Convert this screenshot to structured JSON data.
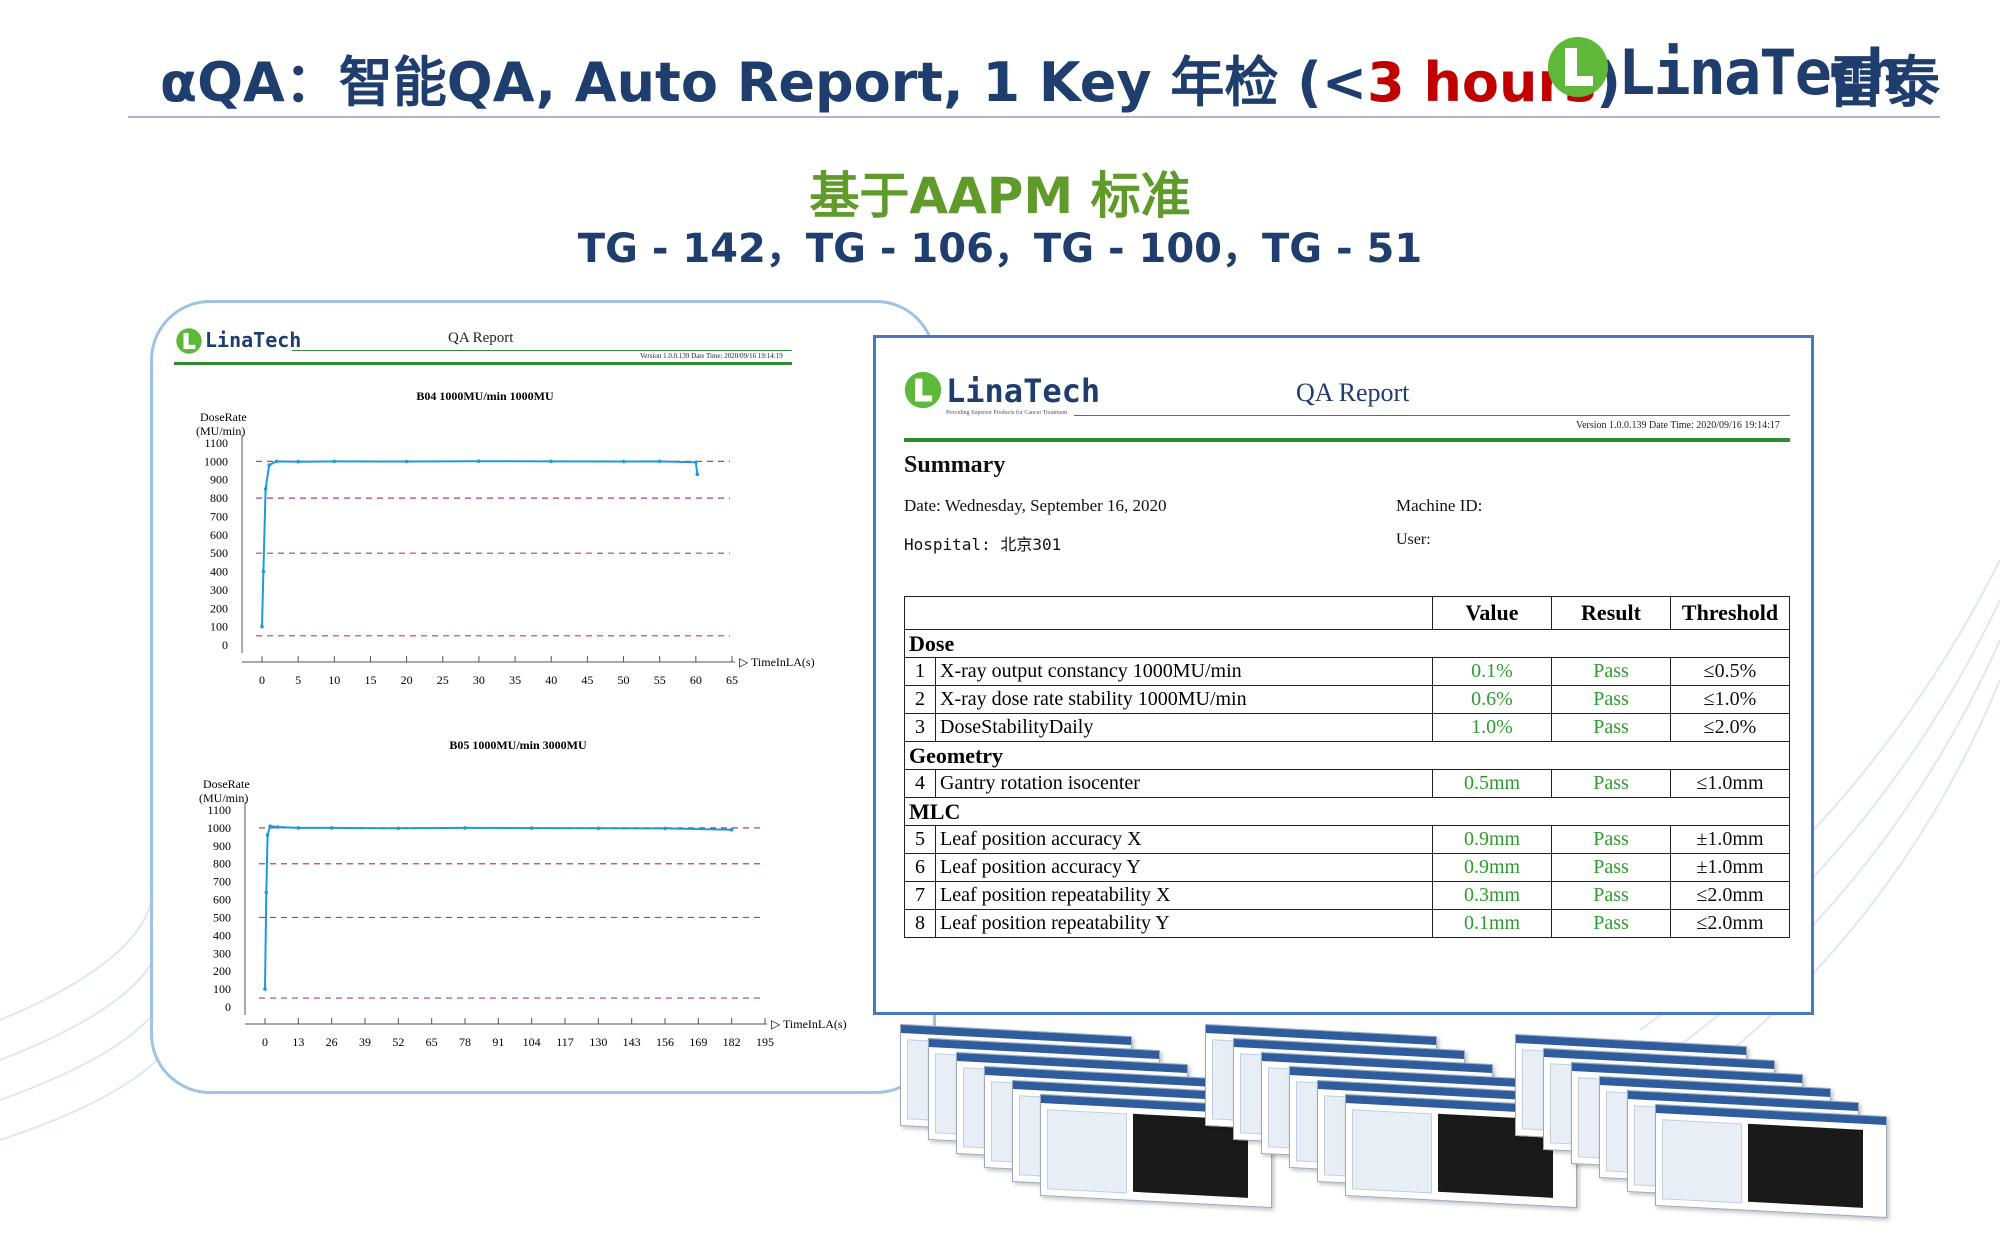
{
  "slide": {
    "title_prefix": "αQA：智能QA, Auto Report, 1 Key 年检 (<",
    "title_highlight": "3 hours",
    "title_suffix": ")",
    "brand_name": "LinaTech",
    "brand_cn": "雷泰",
    "standards_heading": "基于AAPM 标准",
    "standards_list": "TG - 142，TG - 106，TG - 100，TG - 51"
  },
  "colors": {
    "title": "#1f3e6d",
    "highlight": "#c00000",
    "green": "#5f9a2a",
    "series": "#1e9ad6",
    "ref_line": "#b0407e"
  },
  "left_report": {
    "logo": "LinaTech",
    "title": "QA Report",
    "meta": "Version 1.0.0.139    Date Time: 2020/09/16 19:14:19"
  },
  "chart_data": [
    {
      "type": "line",
      "title": "B04 1000MU/min 1000MU",
      "ylabel": "DoseRate\n(MU/min)",
      "xlabel": "TimeInLA(s)",
      "xticks": [
        0,
        5,
        10,
        15,
        20,
        25,
        30,
        35,
        40,
        45,
        50,
        55,
        60,
        65
      ],
      "yticks": [
        0,
        100,
        200,
        300,
        400,
        500,
        600,
        700,
        800,
        900,
        1000,
        1100
      ],
      "xlim": [
        0,
        65
      ],
      "ylim": [
        0,
        1100
      ],
      "reference_lines": [
        1000,
        800,
        500,
        50
      ],
      "series": [
        {
          "x": [
            0,
            0.2,
            0.5,
            1,
            2,
            5,
            10,
            20,
            30,
            40,
            50,
            55,
            60,
            60.2
          ],
          "y": [
            100,
            400,
            850,
            980,
            1000,
            998,
            1000,
            999,
            1001,
            1000,
            999,
            1000,
            995,
            930
          ]
        }
      ]
    },
    {
      "type": "line",
      "title": "B05 1000MU/min 3000MU",
      "ylabel": "DoseRate\n(MU/min)",
      "xlabel": "TimeInLA(s)",
      "xticks": [
        0,
        13,
        26,
        39,
        52,
        65,
        78,
        91,
        104,
        117,
        130,
        143,
        156,
        169,
        182,
        195
      ],
      "yticks": [
        0,
        100,
        200,
        300,
        400,
        500,
        600,
        700,
        800,
        900,
        1000,
        1100
      ],
      "xlim": [
        0,
        195
      ],
      "ylim": [
        0,
        1100
      ],
      "reference_lines": [
        1000,
        800,
        500,
        50
      ],
      "series": [
        {
          "x": [
            0,
            0.5,
            1,
            2,
            5,
            13,
            26,
            52,
            78,
            104,
            130,
            156,
            182
          ],
          "y": [
            100,
            640,
            960,
            1010,
            1005,
            1000,
            1000,
            998,
            1000,
            999,
            998,
            997,
            990
          ]
        }
      ]
    }
  ],
  "report": {
    "logo": "LinaTech",
    "logo_tagline": "Providing Superior Products for Cancer Treatment",
    "title": "QA Report",
    "meta": "Version 1.0.0.139    Date Time: 2020/09/16 19:14:17",
    "summary_heading": "Summary",
    "date": "Date: Wednesday, September 16, 2020",
    "hospital": "Hospital: 北京301",
    "machine_id": "Machine ID:",
    "user": "User:",
    "headers": [
      "Value",
      "Result",
      "Threshold"
    ],
    "sections": [
      {
        "name": "Dose",
        "rows": [
          {
            "n": "1",
            "item": "X-ray output constancy 1000MU/min",
            "value": "0.1%",
            "result": "Pass",
            "threshold": "≤0.5%"
          },
          {
            "n": "2",
            "item": "X-ray dose rate stability 1000MU/min",
            "value": "0.6%",
            "result": "Pass",
            "threshold": "≤1.0%"
          },
          {
            "n": "3",
            "item": "DoseStabilityDaily",
            "value": "1.0%",
            "result": "Pass",
            "threshold": "≤2.0%"
          }
        ]
      },
      {
        "name": "Geometry",
        "rows": [
          {
            "n": "4",
            "item": "Gantry rotation isocenter",
            "value": "0.5mm",
            "result": "Pass",
            "threshold": "≤1.0mm"
          }
        ]
      },
      {
        "name": "MLC",
        "rows": [
          {
            "n": "5",
            "item": "Leaf position accuracy X",
            "value": "0.9mm",
            "result": "Pass",
            "threshold": "±1.0mm"
          },
          {
            "n": "6",
            "item": "Leaf position accuracy Y",
            "value": "0.9mm",
            "result": "Pass",
            "threshold": "±1.0mm"
          },
          {
            "n": "7",
            "item": "Leaf position repeatability X",
            "value": "0.3mm",
            "result": "Pass",
            "threshold": "≤2.0mm"
          },
          {
            "n": "8",
            "item": "Leaf position repeatability Y",
            "value": "0.1mm",
            "result": "Pass",
            "threshold": "≤2.0mm"
          }
        ]
      }
    ]
  }
}
